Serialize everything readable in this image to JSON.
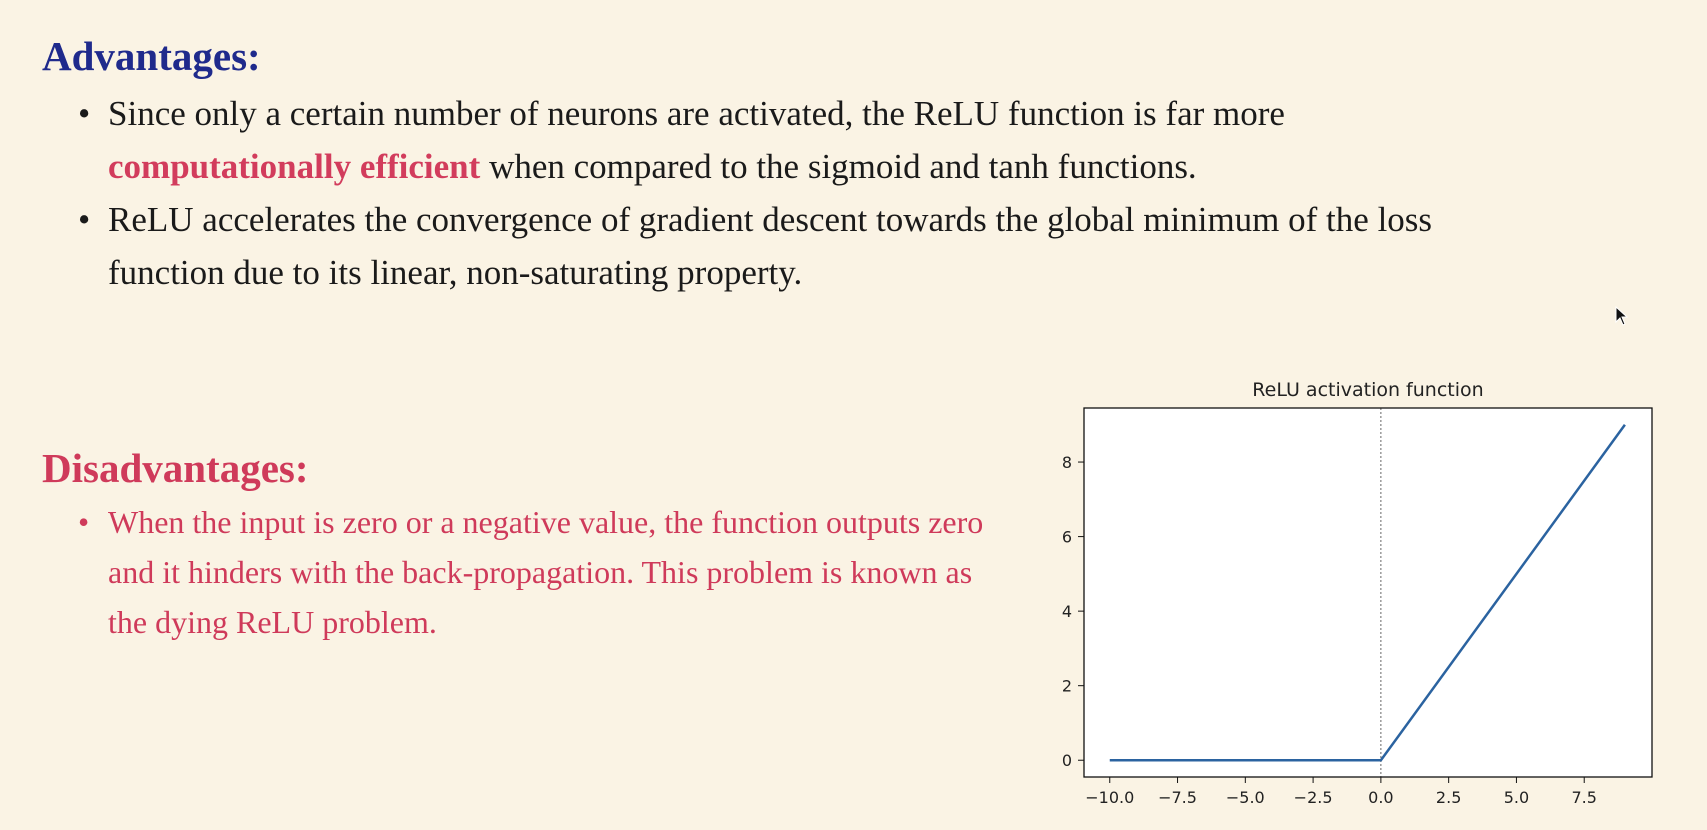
{
  "advantages": {
    "heading": "Advantages:",
    "items": [
      {
        "pre": "Since only a certain number of neurons are activated, the ReLU function is far more ",
        "highlight": "computationally efficient",
        "post": " when compared to the sigmoid and tanh functions."
      },
      {
        "pre": "ReLU accelerates the convergence of gradient descent towards the global minimum of the loss function due to its linear, non-saturating property.",
        "highlight": "",
        "post": ""
      }
    ]
  },
  "disadvantages": {
    "heading": "Disadvantages:",
    "items": [
      "When the input is zero or a negative value, the function outputs zero and it hinders with the back-propagation. This problem is known as the dying ReLU problem."
    ]
  },
  "colors": {
    "background": "#faf3e4",
    "advantages_heading": "#1f2a8c",
    "disadvantages_accent": "#cf3a5a",
    "line": "#2b63a0"
  },
  "chart_data": {
    "type": "line",
    "title": "ReLU activation function",
    "xlabel": "",
    "ylabel": "",
    "xlim": [
      -10.95,
      10.0
    ],
    "ylim": [
      -0.45,
      9.45
    ],
    "xticks": [
      -10.0,
      -7.5,
      -5.0,
      -2.5,
      0.0,
      2.5,
      5.0,
      7.5
    ],
    "xtick_labels": [
      "−10.0",
      "−7.5",
      "−5.0",
      "−2.5",
      "0.0",
      "2.5",
      "5.0",
      "7.5"
    ],
    "yticks": [
      0,
      2,
      4,
      6,
      8
    ],
    "ytick_labels": [
      "0",
      "2",
      "4",
      "6",
      "8"
    ],
    "vline_x": 0,
    "grid": false,
    "series": [
      {
        "x": [
          -10,
          0,
          9
        ],
        "y": [
          0,
          0,
          9
        ]
      }
    ]
  }
}
